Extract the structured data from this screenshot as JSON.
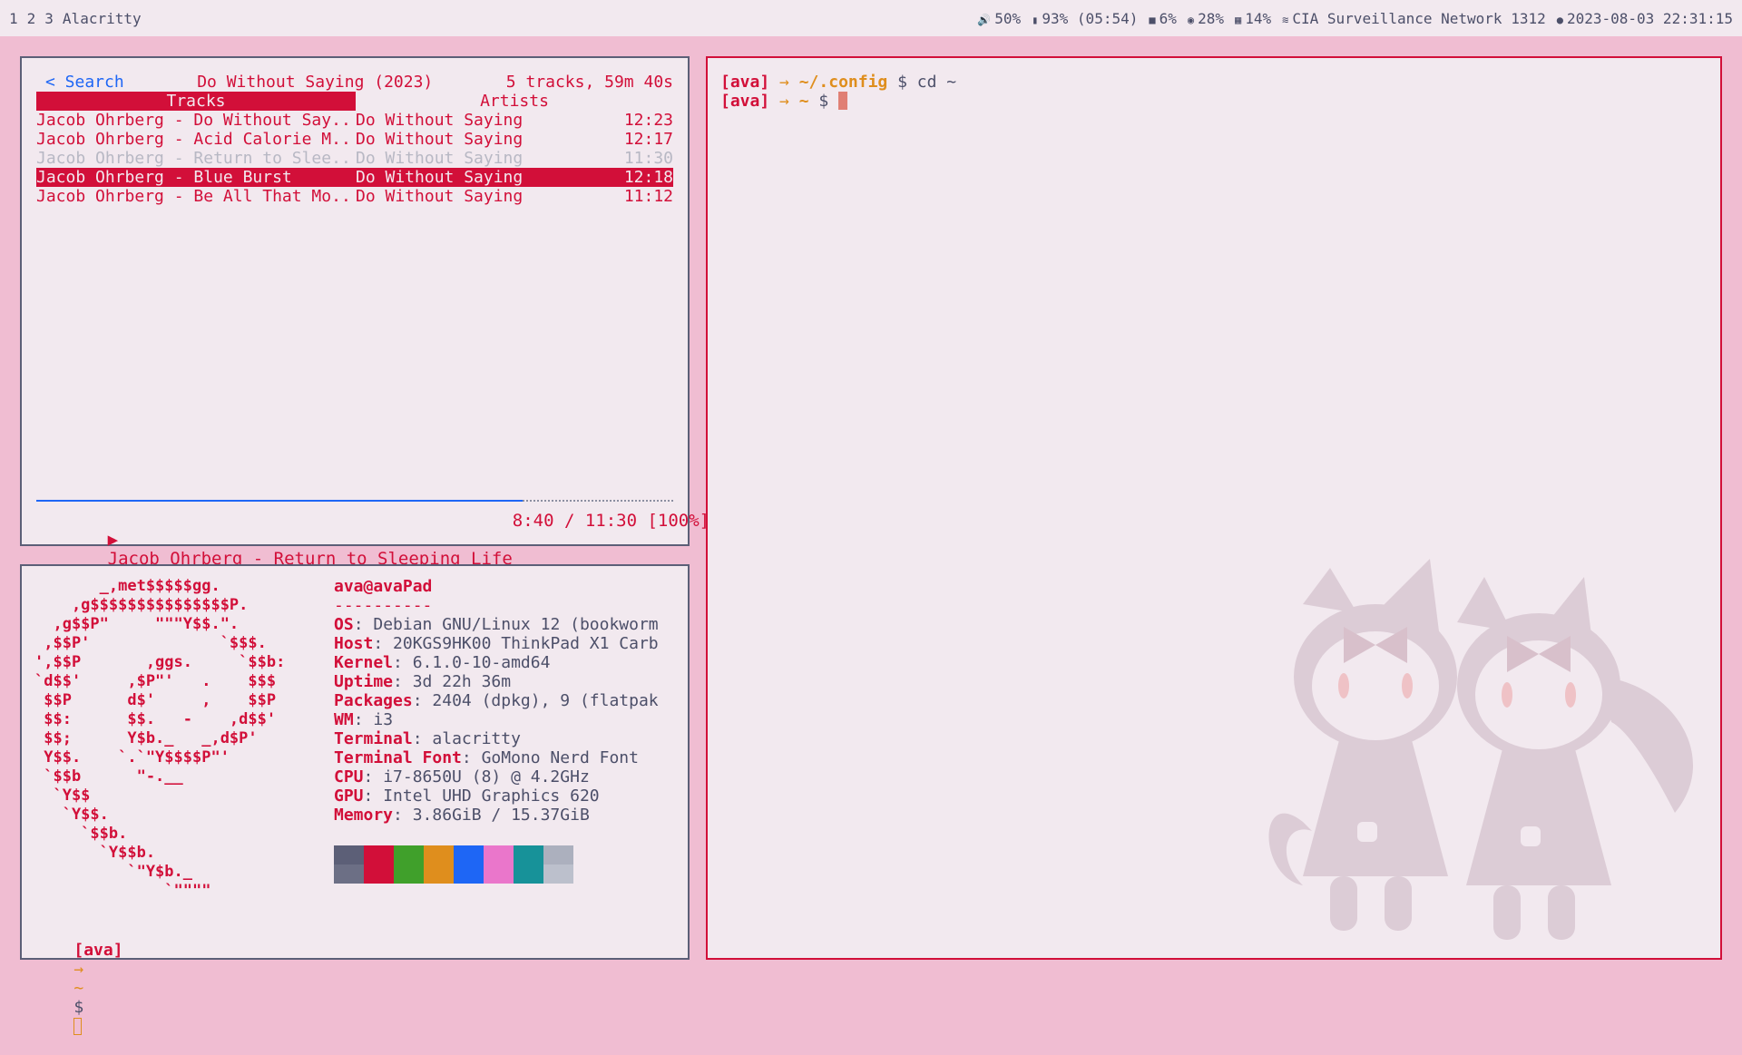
{
  "topbar": {
    "workspaces": [
      "1",
      "2",
      "3"
    ],
    "window_title": "Alacritty",
    "status": [
      {
        "icon": "volume-icon",
        "glyph": "🔊",
        "text": "50%"
      },
      {
        "icon": "battery-icon",
        "glyph": "▮",
        "text": "93% (05:54)"
      },
      {
        "icon": "folder-icon",
        "glyph": "■",
        "text": "6%"
      },
      {
        "icon": "gauge-icon",
        "glyph": "◉",
        "text": "28%"
      },
      {
        "icon": "memory-icon",
        "glyph": "▦",
        "text": "14%"
      },
      {
        "icon": "wifi-icon",
        "glyph": "≋",
        "text": "CIA Surveillance Network 1312"
      },
      {
        "icon": "clock-icon",
        "glyph": "●",
        "text": "2023-08-03 22:31:15"
      }
    ]
  },
  "music": {
    "back_label": "< Search",
    "album_title": "Do Without Saying (2023)",
    "summary": "5 tracks, 59m 40s",
    "tab_tracks": "Tracks",
    "tab_artists": "Artists",
    "tracks": [
      {
        "title": "Jacob Ohrberg - Do Without Say..",
        "album": "Do Without Saying",
        "time": "12:23",
        "state": "normal"
      },
      {
        "title": "Jacob Ohrberg - Acid Calorie M..",
        "album": "Do Without Saying",
        "time": "12:17",
        "state": "normal"
      },
      {
        "title": "Jacob Ohrberg - Return to Slee..",
        "album": "Do Without Saying",
        "time": "11:30",
        "state": "playing"
      },
      {
        "title": "Jacob Ohrberg - Blue Burst",
        "album": "Do Without Saying",
        "time": "12:18",
        "state": "selected"
      },
      {
        "title": "Jacob Ohrberg - Be All That Mo..",
        "album": "Do Without Saying",
        "time": "11:12",
        "state": "normal"
      }
    ],
    "progress_fraction": 0.763,
    "play_glyph": "▶",
    "now_playing": "Jacob Ohrberg - Return to Sleeping Life",
    "position": "8:40 / 11:30 [100%]"
  },
  "fetch": {
    "ascii_logo": "       _,met$$$$$gg.\n    ,g$$$$$$$$$$$$$$$P.\n  ,g$$P\"     \"\"\"Y$$.\".\n ,$$P'              `$$$.\n',$$P       ,ggs.     `$$b:\n`d$$'     ,$P\"'   .    $$$\n $$P      d$'     ,    $$P\n $$:      $$.   -    ,d$$'\n $$;      Y$b._   _,d$P'\n Y$$.    `.`\"Y$$$$P\"'\n `$$b      \"-.__\n  `Y$$\n   `Y$$.\n     `$$b.\n       `Y$$b.\n          `\"Y$b._\n              `\"\"\"\"",
    "user_host": "ava@avaPad",
    "separator": "----------",
    "fields": [
      {
        "key": "OS",
        "value": "Debian GNU/Linux 12 (bookworm"
      },
      {
        "key": "Host",
        "value": "20KGS9HK00 ThinkPad X1 Carb"
      },
      {
        "key": "Kernel",
        "value": "6.1.0-10-amd64"
      },
      {
        "key": "Uptime",
        "value": "3d 22h 36m"
      },
      {
        "key": "Packages",
        "value": "2404 (dpkg), 9 (flatpak"
      },
      {
        "key": "WM",
        "value": "i3"
      },
      {
        "key": "Terminal",
        "value": "alacritty"
      },
      {
        "key": "Terminal Font",
        "value": "GoMono Nerd Font"
      },
      {
        "key": "CPU",
        "value": "i7-8650U (8) @ 4.2GHz"
      },
      {
        "key": "GPU",
        "value": "Intel UHD Graphics 620"
      },
      {
        "key": "Memory",
        "value": "3.86GiB / 15.37GiB"
      }
    ],
    "palette": [
      {
        "top": "#5c5f77",
        "bottom": "#6c6f85"
      },
      {
        "top": "#d20f39",
        "bottom": "#d20f39"
      },
      {
        "top": "#40a02b",
        "bottom": "#40a02b"
      },
      {
        "top": "#df8e1d",
        "bottom": "#df8e1d"
      },
      {
        "top": "#1e66f5",
        "bottom": "#1e66f5"
      },
      {
        "top": "#ea76cb",
        "bottom": "#ea76cb"
      },
      {
        "top": "#179299",
        "bottom": "#179299"
      },
      {
        "top": "#acb0be",
        "bottom": "#bcc0cc"
      }
    ],
    "prompt": {
      "user": "[ava]",
      "arrow": "→",
      "path": "~",
      "symbol": "$"
    }
  },
  "terminal": {
    "lines": [
      {
        "user": "[ava]",
        "arrow": "→",
        "path": "~/.config",
        "symbol": "$",
        "command": "cd ~"
      },
      {
        "user": "[ava]",
        "arrow": "→",
        "path": "~",
        "symbol": "$",
        "command": ""
      }
    ]
  },
  "colors": {
    "accent": "#d20f39",
    "link": "#1e66f5",
    "path": "#df8e1d",
    "background": "#f0bdd2",
    "pane": "#f2e9ef"
  }
}
